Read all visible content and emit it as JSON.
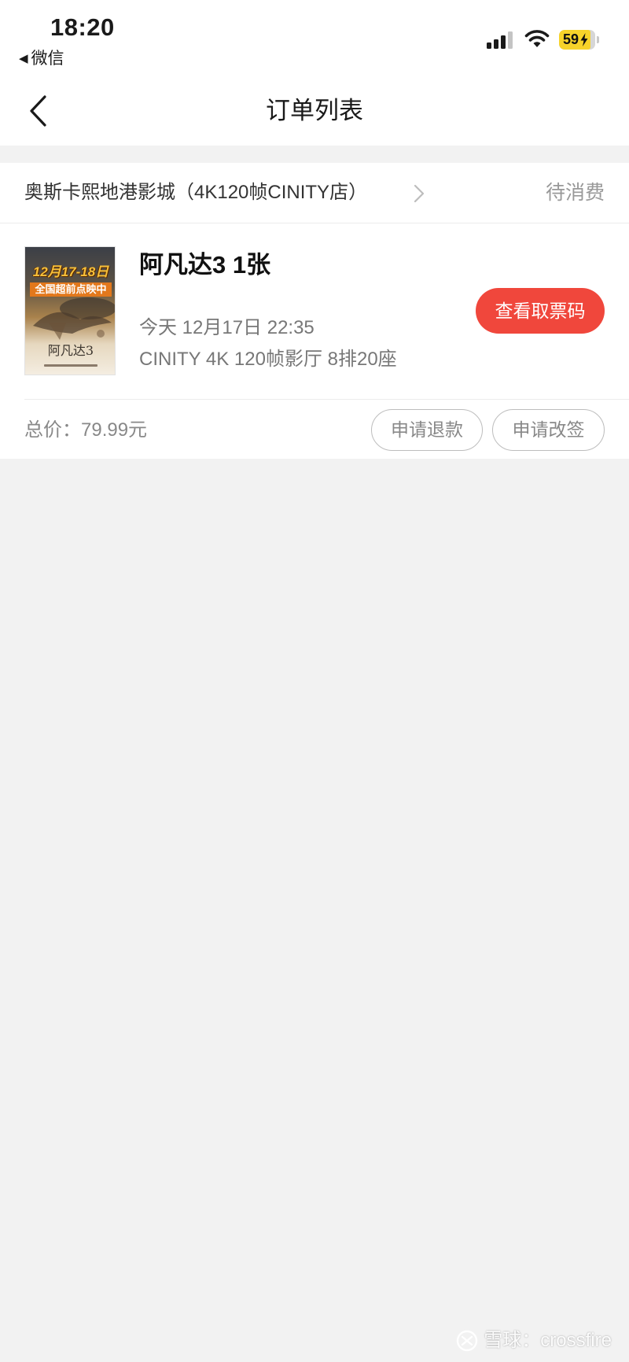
{
  "status_bar": {
    "time": "18:20",
    "back_arrow": "◀",
    "back_app": "微信",
    "battery": "59",
    "icons": [
      "signal-icon",
      "wifi-icon",
      "battery-icon",
      "charging-bolt-icon"
    ]
  },
  "nav": {
    "title": "订单列表",
    "back_icon": "chevron-left-icon"
  },
  "order": {
    "cinema_name": "奥斯卡熙地港影城（4K120帧CINITY店）",
    "status": "待消费",
    "poster": {
      "line1": "12月17-18日",
      "line2": "全国超前点映中",
      "title": "阿凡达3"
    },
    "movie_title": "阿凡达3 1张",
    "showtime": "今天 12月17日 22:35",
    "hall_seat": "CINITY 4K 120帧影厅 8排20座",
    "ticket_button": "查看取票码",
    "total_price": "总价：79.99元",
    "refund_button": "申请退款",
    "change_button": "申请改签"
  },
  "watermark": {
    "text": "雪球：crossfire"
  },
  "colors": {
    "background": "#f2f2f2",
    "card": "#ffffff",
    "accent_red": "#f0473c",
    "battery_yellow": "#f7d32a",
    "secondary_text": "#888888"
  }
}
